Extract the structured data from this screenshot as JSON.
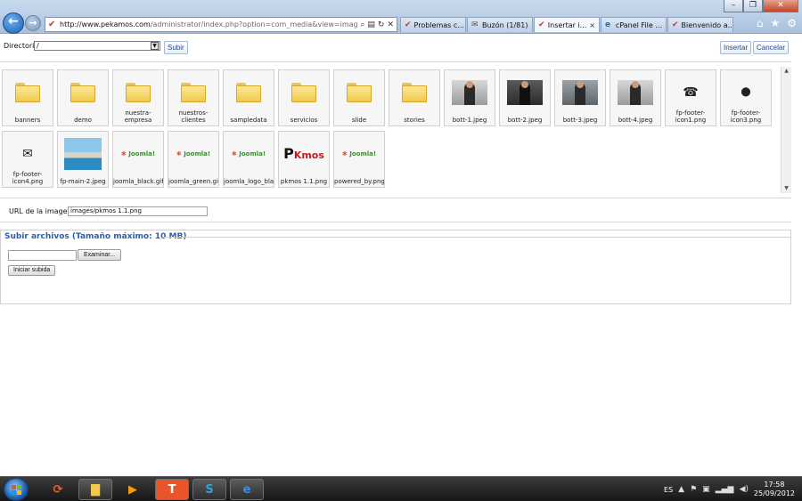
{
  "browser": {
    "address_host": "http://www.pekamos.com",
    "address_path": "/administrator/index.php?option=com_media&view=imag",
    "tabs": [
      {
        "label": "Problemas c...",
        "active": false
      },
      {
        "label": "Buzón (1/81)",
        "active": false
      },
      {
        "label": "Insertar i...",
        "active": true
      },
      {
        "label": "cPanel File ...",
        "active": false
      },
      {
        "label": "Bienvenido a...",
        "active": false
      }
    ],
    "tab_close_glyph": "×"
  },
  "toolbar": {
    "directory_label": "Directorio",
    "directory_value": "/",
    "upload_button": "Subir",
    "insert_button": "Insertar",
    "cancel_button": "Cancelar"
  },
  "media": {
    "items": [
      {
        "label": "banners",
        "kind": "folder"
      },
      {
        "label": "demo",
        "kind": "folder"
      },
      {
        "label": "nuestra-empresa",
        "label_lines": [
          "nuestra-",
          "empresa"
        ],
        "kind": "folder"
      },
      {
        "label": "nuestros-clientes",
        "label_lines": [
          "nuestros-",
          "clientes"
        ],
        "kind": "folder"
      },
      {
        "label": "sampledata",
        "kind": "folder"
      },
      {
        "label": "servicios",
        "kind": "folder"
      },
      {
        "label": "slide",
        "kind": "folder"
      },
      {
        "label": "stories",
        "kind": "folder"
      },
      {
        "label": "bott-1.jpeg",
        "kind": "photo"
      },
      {
        "label": "bott-2.jpeg",
        "kind": "photo"
      },
      {
        "label": "bott-3.jpeg",
        "kind": "photo"
      },
      {
        "label": "bott-4.jpeg",
        "kind": "photo"
      },
      {
        "label": "fp-footer-icon1.png",
        "label_lines": [
          "fp-footer-",
          "icon1.png"
        ],
        "kind": "phone-icon"
      },
      {
        "label": "fp-footer-icon3.png",
        "label_lines": [
          "fp-footer-",
          "icon3.png"
        ],
        "kind": "pin-icon"
      },
      {
        "label": "fp-footer-icon4.png",
        "label_lines": [
          "fp-footer-",
          "icon4.png"
        ],
        "kind": "mail-icon"
      },
      {
        "label": "fp-main-2.jpeg",
        "kind": "pool-photo"
      },
      {
        "label": "joomla_black.gif",
        "kind": "joomla-logo"
      },
      {
        "label": "joomla_green.gif",
        "kind": "joomla-logo"
      },
      {
        "label": "joomla_logo_bla",
        "kind": "joomla-logo"
      },
      {
        "label": "pkmos 1.1.png",
        "kind": "pkmos-logo"
      },
      {
        "label": "powered_by.png",
        "kind": "joomla-logo"
      }
    ],
    "logo_texts": {
      "joomla_small": "Joomla!",
      "pkmos": "P",
      "pkmos_suffix": "Kmos"
    }
  },
  "image_url": {
    "label": "URL de la imagen",
    "value": "images/pkmos 1.1.png"
  },
  "upload": {
    "title": "Subir archivos (Tamaño máximo: 10 MB)",
    "browse_button": "Examinar...",
    "start_button": "Iniciar subida"
  },
  "taskbar": {
    "language": "ES",
    "time": "17:58",
    "date": "25/09/2012",
    "tasks": [
      "app-icon",
      "folder-icon",
      "media-icon",
      "t-app-icon",
      "skype-icon",
      "ie-icon"
    ]
  },
  "colors": {
    "accent_link": "#1e4f9a",
    "upload_title": "#2a5fb0",
    "folder": "#f1c94a"
  }
}
